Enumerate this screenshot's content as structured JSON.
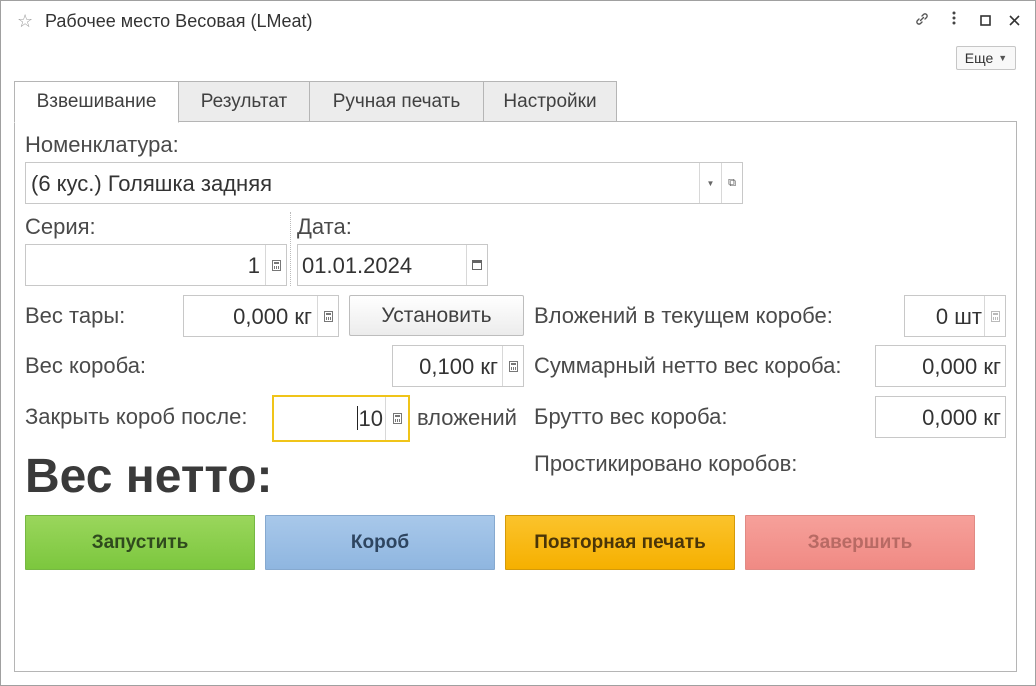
{
  "window": {
    "title": "Рабочее место Весовая (LMeat)",
    "more_label": "Еще",
    "icons": [
      "star-icon",
      "link-icon",
      "more-vertical-icon",
      "maximize-icon",
      "close-icon"
    ]
  },
  "tabs": [
    {
      "label": "Взвешивание",
      "active": true
    },
    {
      "label": "Результат",
      "active": false
    },
    {
      "label": "Ручная печать",
      "active": false
    },
    {
      "label": "Настройки",
      "active": false
    }
  ],
  "form": {
    "nomenclature_label": "Номенклатура:",
    "nomenclature_value": "(6 кус.) Голяшка задняя",
    "series_label": "Серия:",
    "series_value": "1",
    "date_label": "Дата:",
    "date_value": "01.01.2024",
    "tare_label": "Вес тары:",
    "tare_value": "0,000 кг",
    "set_button": "Установить",
    "box_weight_label": "Вес короба:",
    "box_weight_value": "0,100 кг",
    "close_after_label": "Закрыть короб после:",
    "close_after_value": "10",
    "close_after_suffix": "вложений",
    "nested_label": "Вложений в текущем коробе:",
    "nested_value": "0 шт",
    "net_sum_label": "Суммарный нетто вес короба:",
    "net_sum_value": "0,000 кг",
    "gross_label": "Брутто вес короба:",
    "gross_value": "0,000 кг",
    "stickered_label": "Простикировано коробов:",
    "net_weight_title": "Вес нетто:"
  },
  "actions": {
    "start": "Запустить",
    "box": "Короб",
    "reprint": "Повторная печать",
    "finish": "Завершить"
  },
  "colors": {
    "start": "#8ccf4c",
    "box": "#9bbfe6",
    "reprint": "#f8b914",
    "finish": "#f3958f",
    "focus_border": "#f0c419"
  }
}
